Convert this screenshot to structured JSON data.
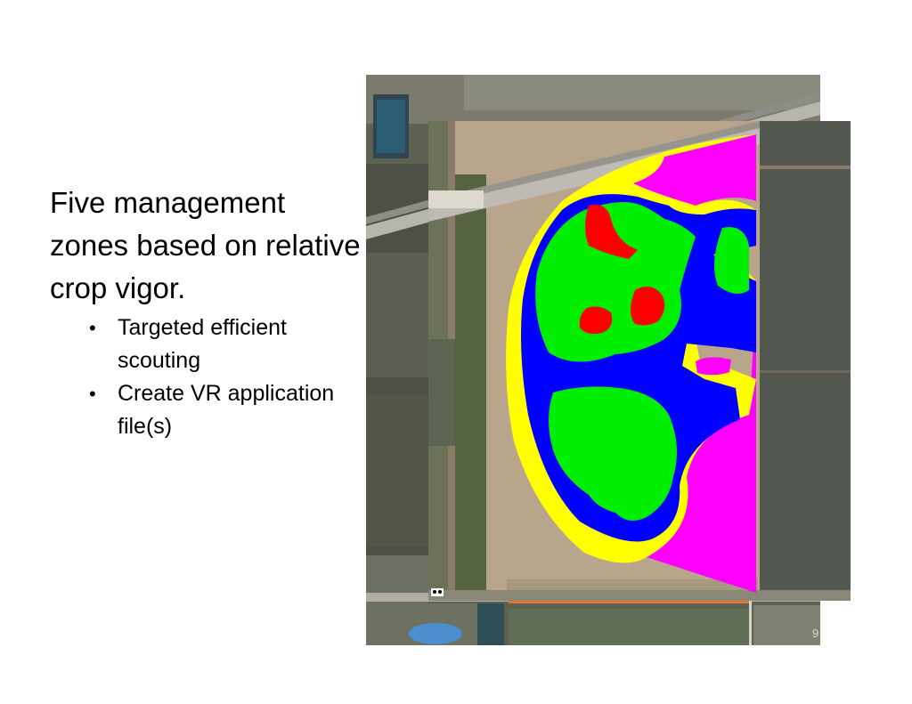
{
  "slide": {
    "heading": "Five management zones based on relative crop vigor.",
    "bullets": [
      "Targeted efficient scouting",
      "Create VR application file(s)"
    ]
  },
  "image_labels": {
    "page_number_fragment": "9"
  },
  "zone_colors": {
    "zone_1": "#ff0000",
    "zone_2": "#00ee00",
    "zone_3": "#0000ff",
    "zone_4": "#ffff00",
    "zone_5": "#ff00ff"
  },
  "icons": [
    "bullet-dot-icon",
    "satellite-image",
    "zone-map-image"
  ]
}
